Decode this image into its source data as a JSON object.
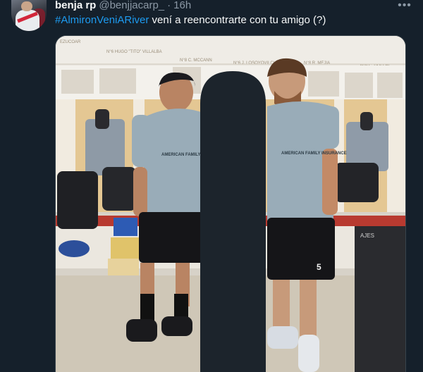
{
  "tweet": {
    "display_name": "benja rp",
    "handle": "@benjjacarp_",
    "separator": "·",
    "time": "16h",
    "hashtag": "#AlmironVeniARiver",
    "text": " vení a reencontrarte con tu amigo (?)",
    "more_icon": "ellipsis-icon"
  },
  "colors": {
    "background": "#15202b",
    "link": "#1d9bf0",
    "secondary_text": "#8b98a5",
    "primary_text": "#f7f9f9",
    "border": "#38444d"
  },
  "media": {
    "locker_nameplates": [
      "EZUCOAR",
      "N°6 HUGO \"TITO\" VILLALBA",
      "N°8 C. MCCANN",
      "N°6 J. LOSOYOVILCH",
      "N°8 R. MEJIA",
      "N°9 C. DOLLIN"
    ],
    "jersey_sponsor": "AMERICAN FAMILY INSURANCE",
    "shorts_number": "5",
    "bin_label": "AJES"
  }
}
